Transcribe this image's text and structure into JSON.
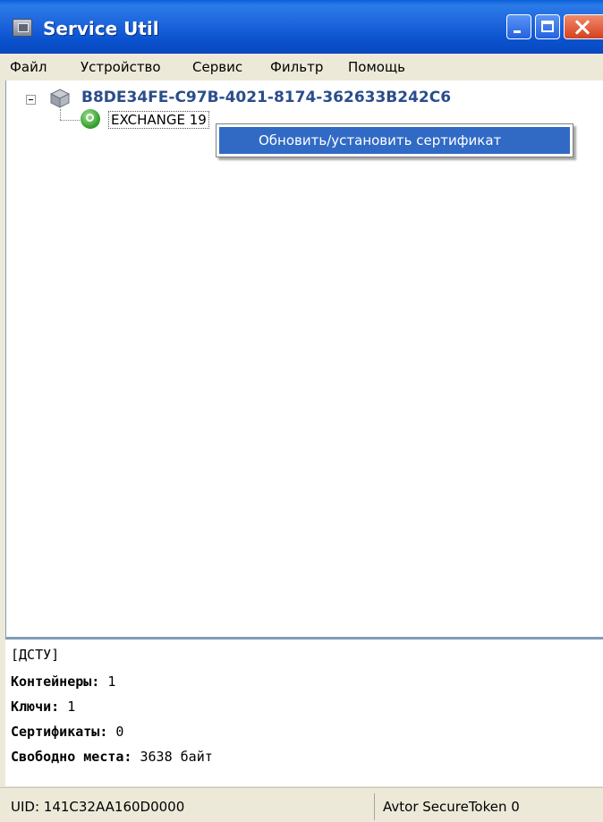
{
  "window": {
    "title": "Service Util"
  },
  "menu": [
    "Файл",
    "Устройство",
    "Сервис",
    "Фильтр",
    "Помощь"
  ],
  "tree": {
    "device": "B8DE34FE-C97B-4021-8174-362633B242C6",
    "container": "EXCHANGE 19"
  },
  "context_menu": {
    "item": "Обновить/установить сертификат"
  },
  "info": {
    "header": "[ДСТУ]",
    "containers_label": "Контейнеры:",
    "containers_value": "1",
    "keys_label": "Ключи:",
    "keys_value": "1",
    "certs_label": "Сертификаты:",
    "certs_value": "0",
    "free_label": "Свободно места:",
    "free_value": "3638 байт"
  },
  "status": {
    "uid": "UID: 141C32AA160D0000",
    "device_type": "Avtor SecureToken 0"
  }
}
